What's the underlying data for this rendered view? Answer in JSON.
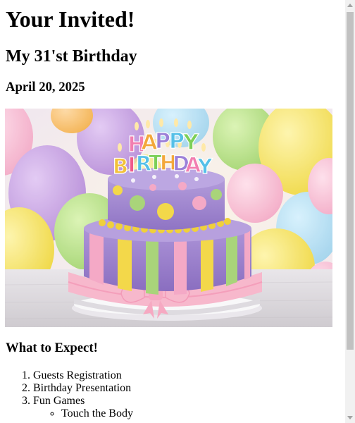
{
  "invite": {
    "heading": "Your Invited!",
    "subheading": "My 31'st Birthday",
    "date": "April 20, 2025"
  },
  "photo": {
    "candle_letters_top": [
      "H",
      "A",
      "P",
      "P",
      "Y"
    ],
    "candle_letters_bottom": [
      "B",
      "I",
      "R",
      "T",
      "H",
      "D",
      "A",
      "Y"
    ],
    "colors": {
      "cake_purple": "#a98fd0",
      "cake_yellow": "#f3d84a",
      "cake_green": "#a9d47a",
      "cake_pink": "#f4a9c6",
      "ribbon_pink": "#f7b8cc"
    }
  },
  "expect": {
    "heading": "What to Expect!",
    "items": [
      "Guests Registration",
      "Birthday Presentation",
      "Fun Games"
    ],
    "subitems": [
      "Touch the Body"
    ]
  },
  "scrollbar": {
    "icons": [
      "scroll-up-arrow-icon",
      "scroll-down-arrow-icon"
    ]
  }
}
